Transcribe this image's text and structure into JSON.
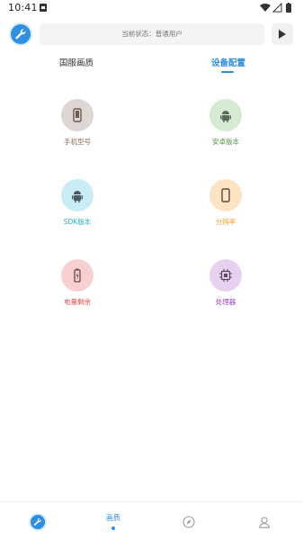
{
  "status_bar": {
    "time": "10:41"
  },
  "header": {
    "status_text": "当前状态：普通用户"
  },
  "tabs": [
    {
      "label": "国服画质",
      "active": false
    },
    {
      "label": "设备配置",
      "active": true
    }
  ],
  "grid": [
    {
      "label": "手机型号",
      "icon": "phone-icon",
      "color": "#8a6d5c"
    },
    {
      "label": "安卓版本",
      "icon": "android-icon",
      "color": "#4f9a45"
    },
    {
      "label": "SDK版本",
      "icon": "sdk-icon",
      "color": "#2ab0cc"
    },
    {
      "label": "分辨率",
      "icon": "resolution-icon",
      "color": "#f0a02b"
    },
    {
      "label": "电量剩余",
      "icon": "battery-icon",
      "color": "#e84a4a"
    },
    {
      "label": "处理器",
      "icon": "cpu-icon",
      "color": "#a23ec8"
    }
  ],
  "bottom_nav": [
    {
      "label": "",
      "icon": "wrench-icon"
    },
    {
      "label": "画质",
      "icon": "",
      "active": true
    },
    {
      "label": "",
      "icon": "compass-icon"
    },
    {
      "label": "",
      "icon": "user-icon"
    }
  ],
  "colors": {
    "accent": "#2f8fe3"
  }
}
